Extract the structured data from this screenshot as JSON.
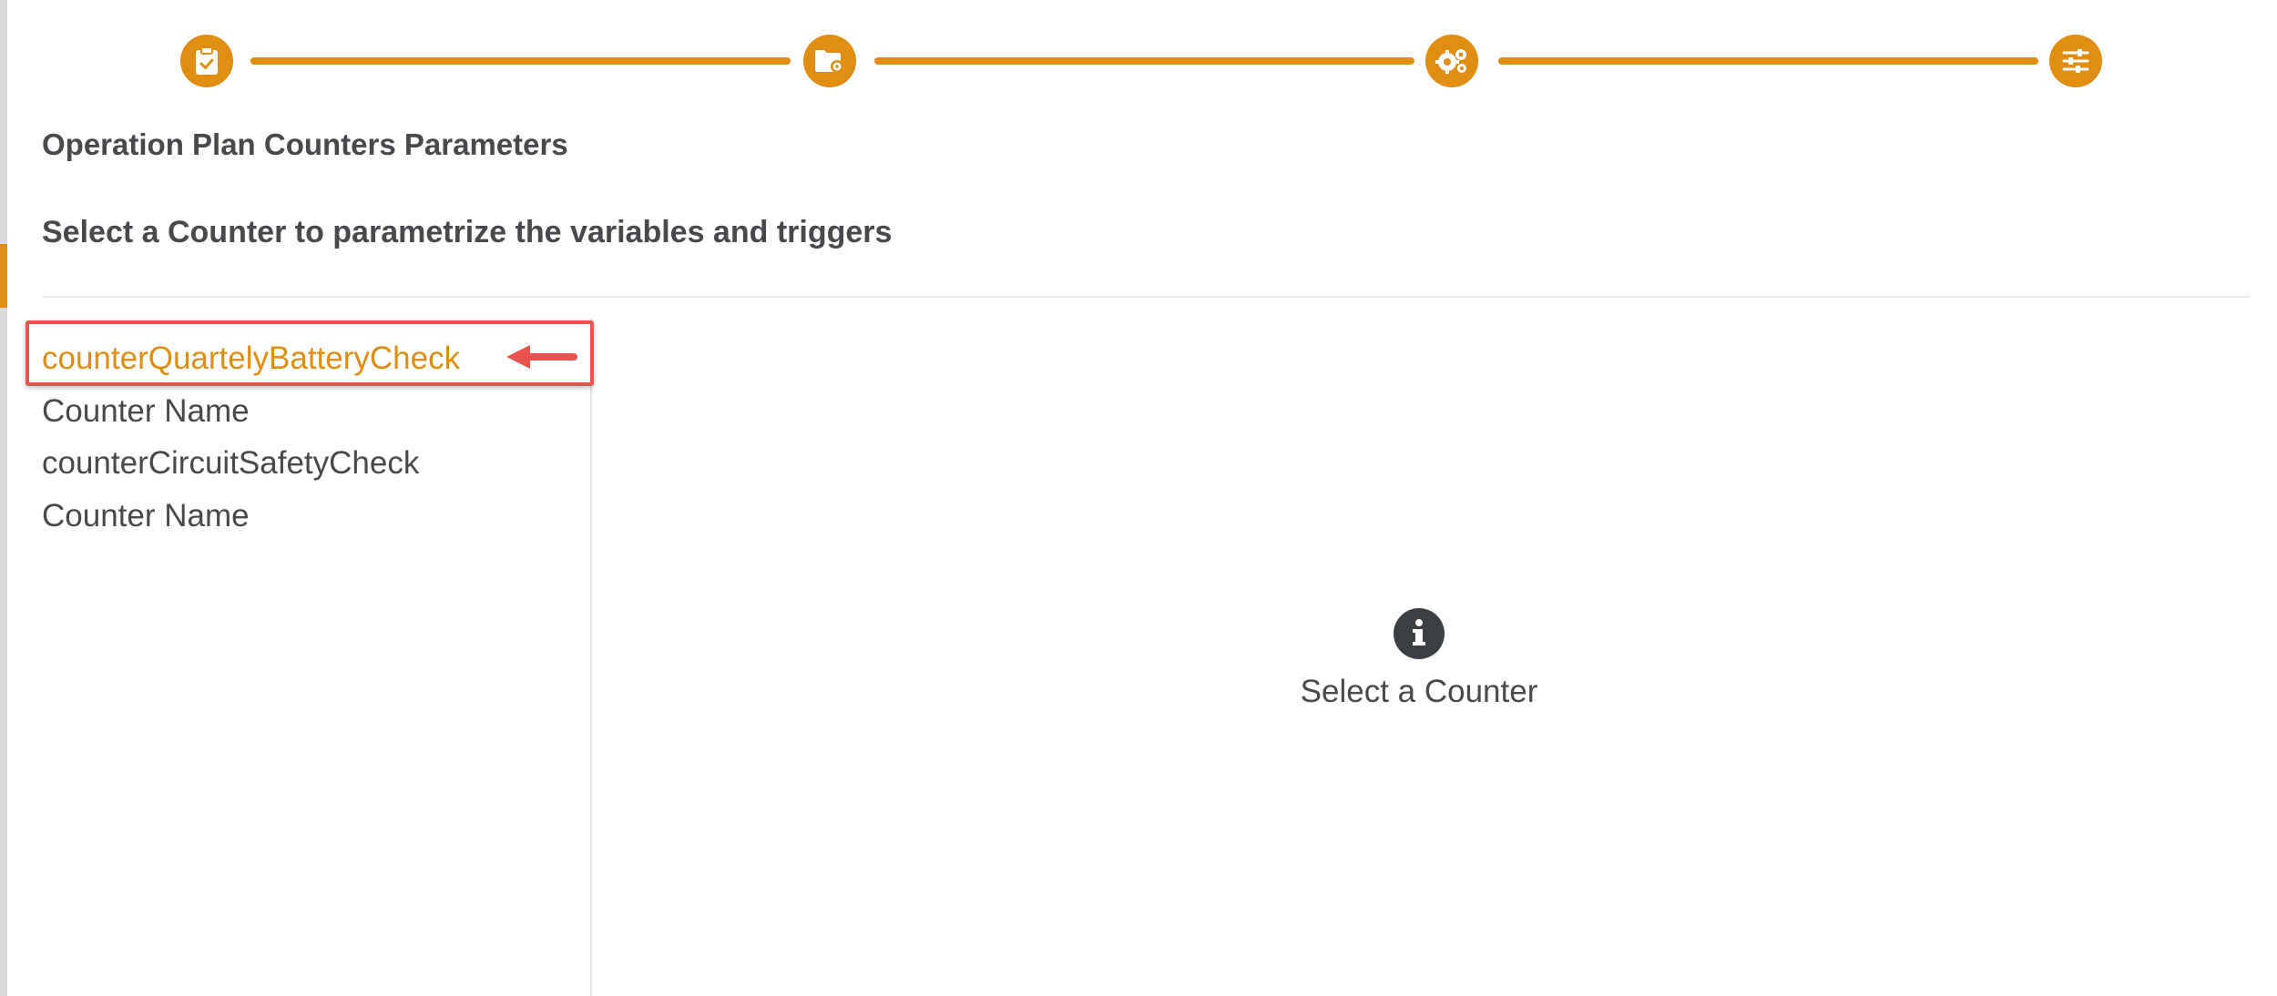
{
  "stepper": {
    "color": "#e08e12",
    "steps": [
      {
        "icon": "clipboard-check-icon"
      },
      {
        "icon": "folder-gear-icon"
      },
      {
        "icon": "gears-icon"
      },
      {
        "icon": "sliders-icon"
      }
    ]
  },
  "page": {
    "title": "Operation Plan Counters Parameters",
    "subtitle": "Select a Counter to parametrize the variables and triggers"
  },
  "counters": {
    "items": [
      {
        "label": "counterQuartelyBatteryCheck",
        "selected": true
      },
      {
        "label": "Counter Name",
        "selected": false
      },
      {
        "label": "counterCircuitSafetyCheck",
        "selected": false
      },
      {
        "label": "Counter Name",
        "selected": false
      }
    ]
  },
  "empty_state": {
    "icon": "info-icon",
    "text": "Select a Counter"
  },
  "colors": {
    "accent": "#e08e12",
    "text": "#48494d",
    "annotation": "#e8534e"
  }
}
